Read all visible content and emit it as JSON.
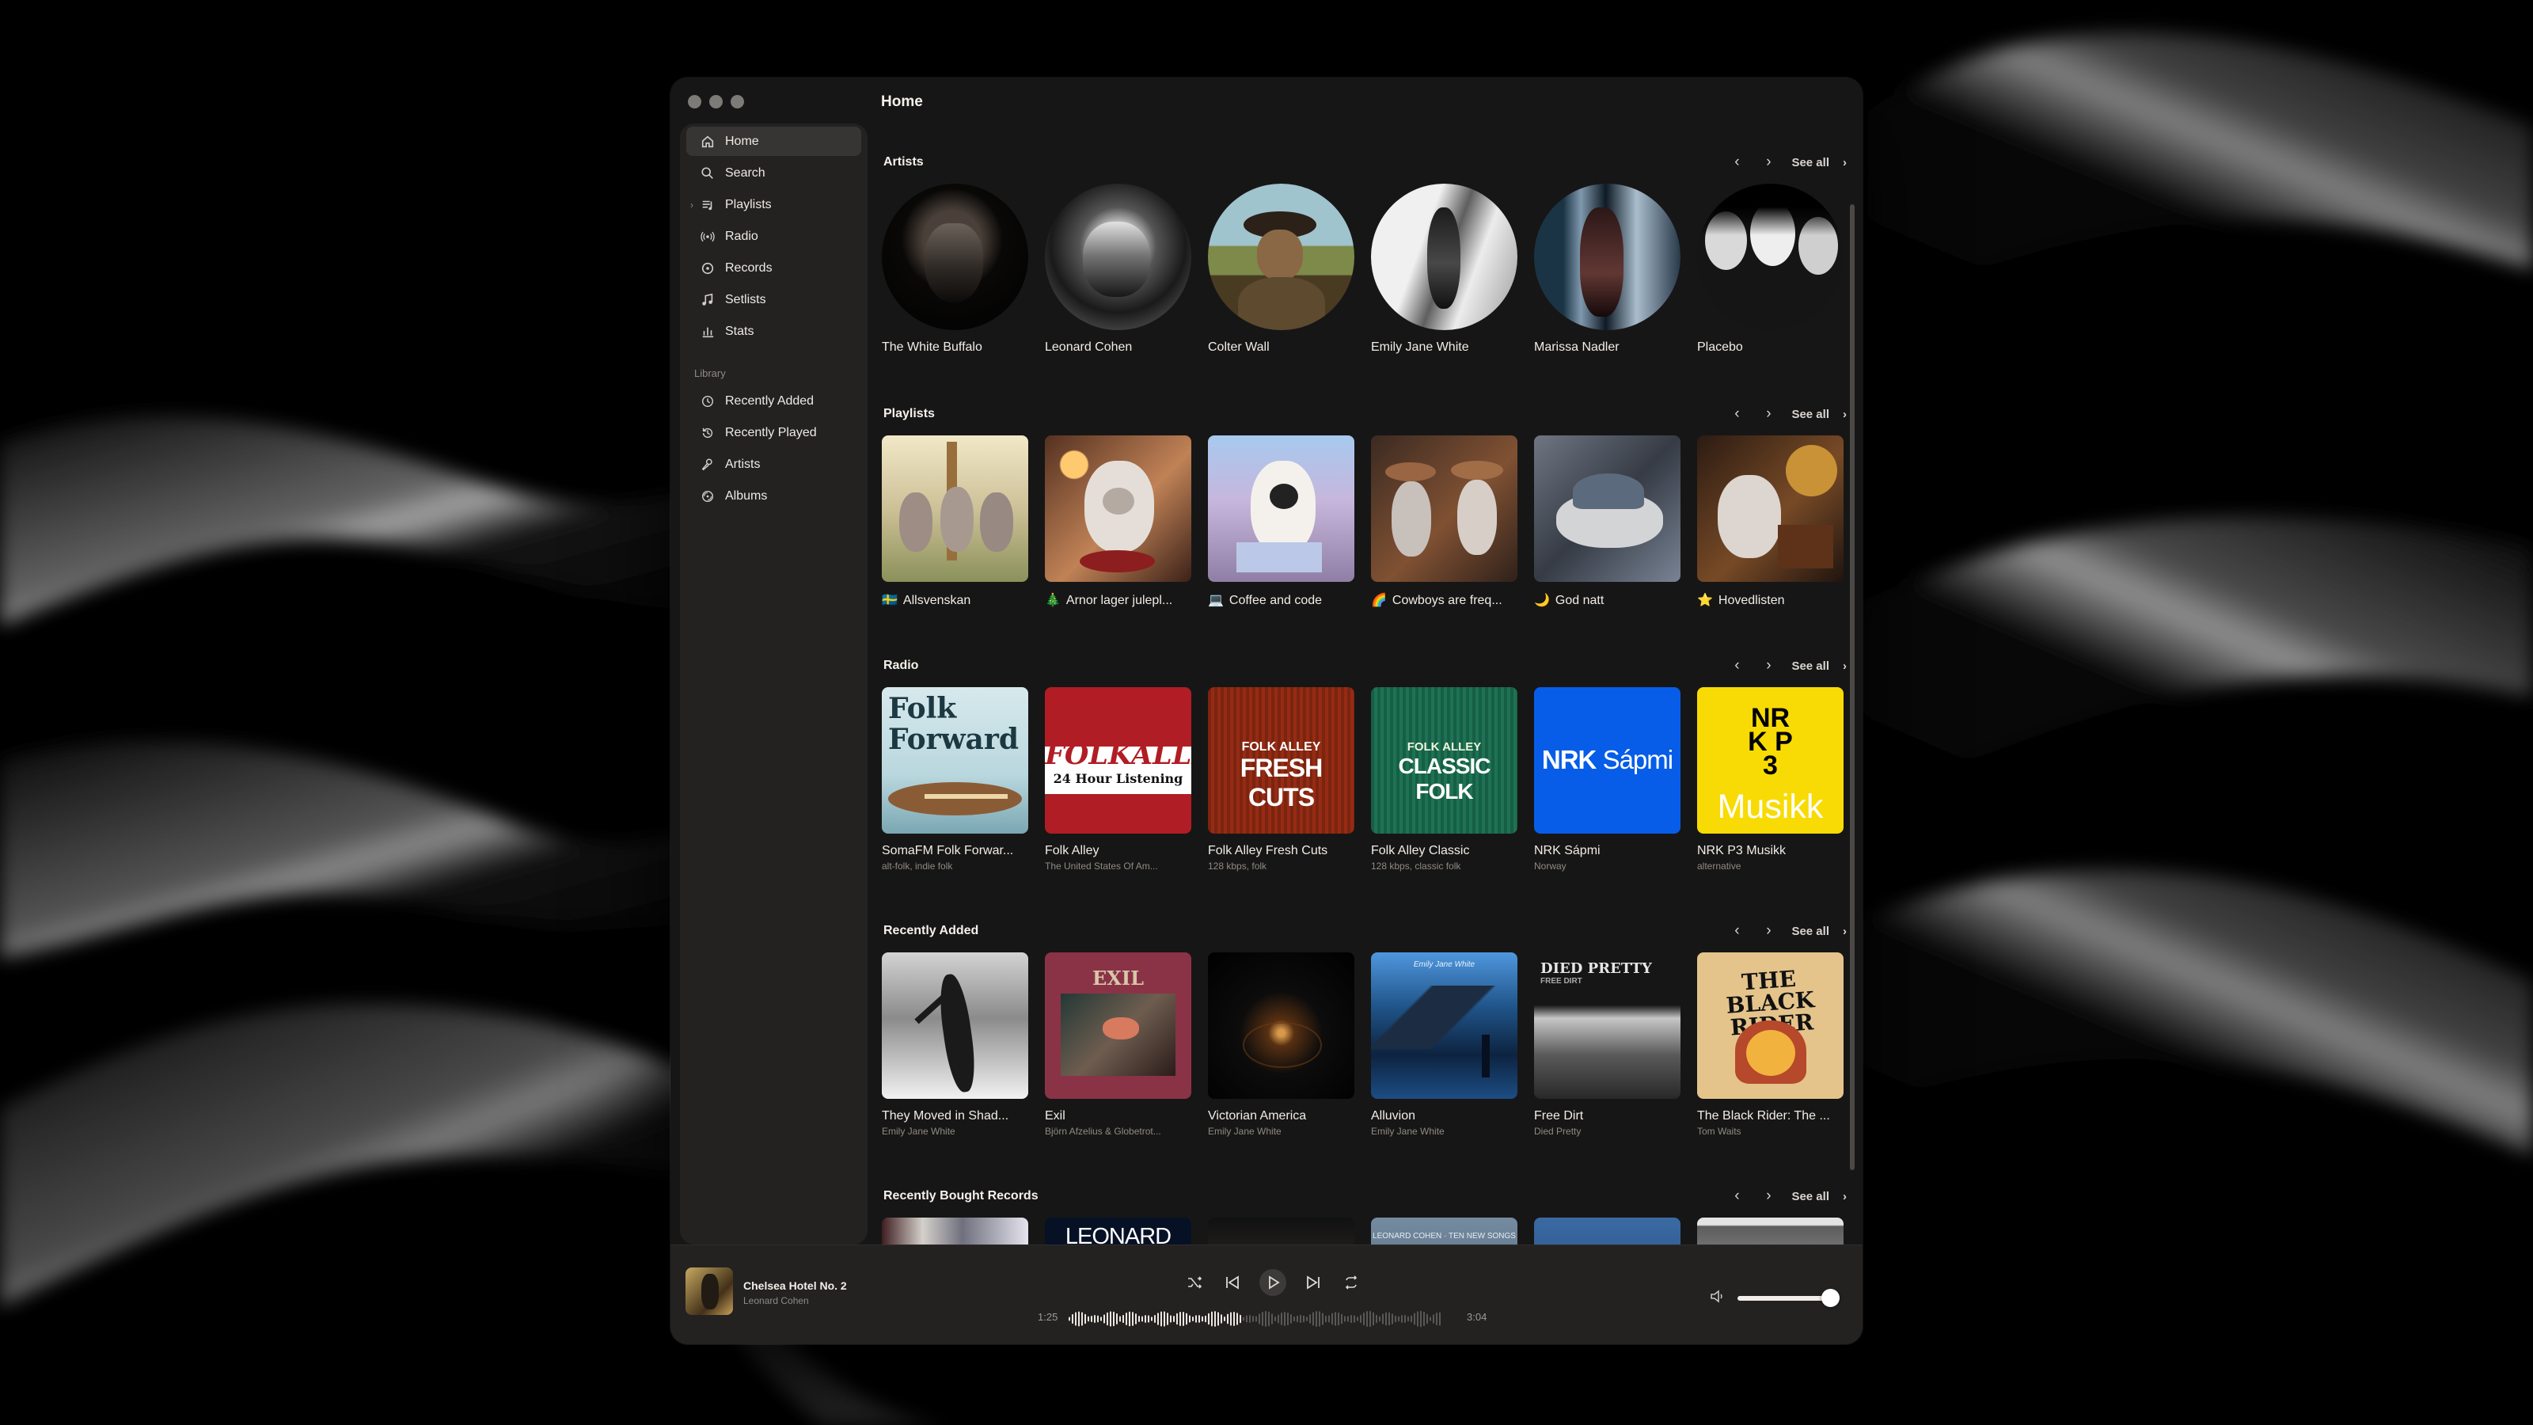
{
  "window": {
    "title": "Home"
  },
  "sidebar": {
    "items": [
      {
        "label": "Home",
        "icon": "home-icon",
        "active": true
      },
      {
        "label": "Search",
        "icon": "search-icon"
      },
      {
        "label": "Playlists",
        "icon": "playlist-icon",
        "expandable": true
      },
      {
        "label": "Radio",
        "icon": "radio-icon"
      },
      {
        "label": "Records",
        "icon": "record-icon"
      },
      {
        "label": "Setlists",
        "icon": "music-note-icon"
      },
      {
        "label": "Stats",
        "icon": "bar-chart-icon"
      }
    ],
    "library_title": "Library",
    "library_items": [
      {
        "label": "Recently Added",
        "icon": "clock-icon"
      },
      {
        "label": "Recently Played",
        "icon": "history-icon"
      },
      {
        "label": "Artists",
        "icon": "microphone-icon"
      },
      {
        "label": "Albums",
        "icon": "album-icon"
      }
    ]
  },
  "sections": {
    "see_all": "See all",
    "artists": {
      "title": "Artists",
      "items": [
        {
          "label": "The White Buffalo"
        },
        {
          "label": "Leonard Cohen"
        },
        {
          "label": "Colter Wall"
        },
        {
          "label": "Emily Jane White"
        },
        {
          "label": "Marissa Nadler"
        },
        {
          "label": "Placebo"
        }
      ]
    },
    "playlists": {
      "title": "Playlists",
      "items": [
        {
          "emoji": "🇸🇪",
          "label": "Allsvenskan"
        },
        {
          "emoji": "🎄",
          "label": "Arnor lager julepl..."
        },
        {
          "emoji": "💻",
          "label": "Coffee and code"
        },
        {
          "emoji": "🌈",
          "label": "Cowboys are freq..."
        },
        {
          "emoji": "🌙",
          "label": "God natt"
        },
        {
          "emoji": "⭐",
          "label": "Hovedlisten"
        }
      ]
    },
    "radio": {
      "title": "Radio",
      "items": [
        {
          "label": "SomaFM Folk Forwar...",
          "sub": "alt-folk, indie folk",
          "cover_line1": "Folk",
          "cover_line2": "Forward"
        },
        {
          "label": "Folk Alley",
          "sub": "The United States Of Am...",
          "cover_line1": "FOLKALLEY",
          "cover_line2": "24 Hour Listening"
        },
        {
          "label": "Folk Alley Fresh Cuts",
          "sub": "128 kbps, folk",
          "cover_line1": "FOLK ALLEY",
          "cover_line2": "FRESH CUTS"
        },
        {
          "label": "Folk Alley Classic",
          "sub": "128 kbps, classic folk",
          "cover_line1": "FOLK ALLEY",
          "cover_line2": "CLASSIC FOLK"
        },
        {
          "label": "NRK Sápmi",
          "sub": "Norway",
          "cover_line1": "NRK",
          "cover_line2": "Sápmi"
        },
        {
          "label": "NRK P3 Musikk",
          "sub": "alternative",
          "cover_line1": "NRK P3",
          "cover_line2": "Musikk"
        }
      ]
    },
    "recently_added": {
      "title": "Recently Added",
      "items": [
        {
          "label": "They Moved in Shad...",
          "sub": "Emily Jane White"
        },
        {
          "label": "Exil",
          "sub": "Björn Afzelius & Globetrot...",
          "cover_text": "EXIL"
        },
        {
          "label": "Victorian America",
          "sub": "Emily Jane White"
        },
        {
          "label": "Alluvion",
          "sub": "Emily Jane White",
          "cover_text": "Emily Jane White"
        },
        {
          "label": "Free Dirt",
          "sub": "Died Pretty",
          "cover_text": "DIED PRETTY",
          "cover_sub": "FREE DIRT"
        },
        {
          "label": "The Black Rider: The ...",
          "sub": "Tom Waits",
          "cover_text": "THE BLACK RIDER"
        }
      ]
    },
    "recent_records": {
      "title": "Recently Bought Records",
      "items": [
        {
          "cover_text": ""
        },
        {
          "cover_text": "LEONARD"
        },
        {
          "cover_text": ""
        },
        {
          "cover_text": "LEONARD COHEN · TEN NEW SONGS"
        },
        {
          "cover_text": ""
        },
        {
          "cover_text": ""
        }
      ]
    }
  },
  "player": {
    "track": "Chelsea Hotel No. 2",
    "artist": "Leonard Cohen",
    "elapsed": "1:25",
    "duration": "3:04",
    "progress": 0.46,
    "volume": 0.93
  },
  "colors": {
    "accent": "#f2eee8",
    "folk_alley_red": "#b11d25",
    "nrk_sapmi": "#075de8",
    "nrk_p3": "#f8db04"
  }
}
